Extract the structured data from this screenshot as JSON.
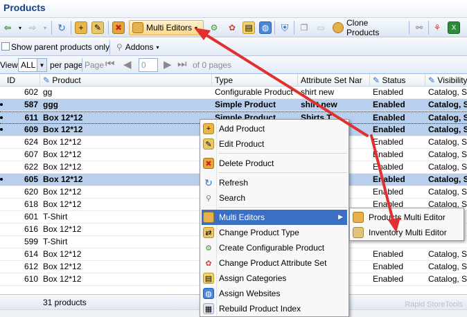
{
  "window": {
    "title": "Products"
  },
  "toolbar": {
    "multi_editors_label": "Multi Editors",
    "clone_products_label": "Clone Products"
  },
  "filters": {
    "show_parent_label": "Show parent products only",
    "addons_label": "Addons"
  },
  "pager": {
    "view_label": "View",
    "per_page_value": "ALL",
    "per_page_label": "per page",
    "page_label": "Page",
    "page_value": "0",
    "of_pages": "of 0 pages"
  },
  "grid": {
    "columns": [
      "ID",
      "Product",
      "Type",
      "Attribute Set Nar",
      "Status",
      "Visibility"
    ],
    "rows": [
      {
        "id": "602",
        "product": "gg",
        "type": "Configurable Product",
        "attr": "shirt new",
        "status": "Enabled",
        "visibility": "Catalog, Sea",
        "selected": false
      },
      {
        "id": "587",
        "product": "ggg",
        "type": "Simple Product",
        "attr": "shirt new",
        "status": "Enabled",
        "visibility": "Catalog, Sea",
        "selected": true
      },
      {
        "id": "611",
        "product": "Box 12*12",
        "type": "Simple Product",
        "attr": "Shirts T",
        "status": "Enabled",
        "visibility": "Catalog, Sea",
        "selected": true
      },
      {
        "id": "609",
        "product": "Box 12*12",
        "type": "",
        "attr": "",
        "status": "Enabled",
        "visibility": "Catalog, Sea",
        "selected": true
      },
      {
        "id": "624",
        "product": "Box 12*12",
        "type": "",
        "attr": "",
        "status": "Enabled",
        "visibility": "Catalog, Sea",
        "selected": false
      },
      {
        "id": "607",
        "product": "Box 12*12",
        "type": "",
        "attr": "",
        "status": "Enabled",
        "visibility": "Catalog, Sea",
        "selected": false
      },
      {
        "id": "622",
        "product": "Box 12*12",
        "type": "",
        "attr": "",
        "status": "Enabled",
        "visibility": "Catalog, Sea",
        "selected": false
      },
      {
        "id": "605",
        "product": "Box 12*12",
        "type": "",
        "attr": "",
        "status": "Enabled",
        "visibility": "Catalog, Sea",
        "selected": true
      },
      {
        "id": "620",
        "product": "Box 12*12",
        "type": "",
        "attr": "",
        "status": "Enabled",
        "visibility": "Catalog, Sea",
        "selected": false
      },
      {
        "id": "618",
        "product": "Box 12*12",
        "type": "",
        "attr": "",
        "status": "Enabled",
        "visibility": "Catalog, Sea",
        "selected": false
      },
      {
        "id": "601",
        "product": "T-Shirt",
        "type": "",
        "attr": "",
        "status": "",
        "visibility": "",
        "selected": false
      },
      {
        "id": "616",
        "product": "Box 12*12",
        "type": "",
        "attr": "",
        "status": "",
        "visibility": "",
        "selected": false
      },
      {
        "id": "599",
        "product": "T-Shirt",
        "type": "",
        "attr": "",
        "status": "",
        "visibility": "",
        "selected": false
      },
      {
        "id": "614",
        "product": "Box 12*12",
        "type": "",
        "attr": "",
        "status": "Enabled",
        "visibility": "Catalog, Sea",
        "selected": false
      },
      {
        "id": "612",
        "product": "Box 12*12",
        "type": "",
        "attr": "",
        "status": "Enabled",
        "visibility": "Catalog, Sea",
        "selected": false
      },
      {
        "id": "610",
        "product": "Box 12*12",
        "type": "",
        "attr": "",
        "status": "Enabled",
        "visibility": "Catalog, Sea",
        "selected": false
      }
    ],
    "footer_count": "31 products"
  },
  "context_menu": {
    "items": [
      {
        "label": "Add Product",
        "icon": "add-product-icon"
      },
      {
        "label": "Edit Product",
        "icon": "edit-product-icon"
      },
      {
        "label": "Delete Product",
        "icon": "delete-product-icon"
      },
      {
        "label": "Refresh",
        "icon": "refresh-icon"
      },
      {
        "label": "Search",
        "icon": "search-icon"
      },
      {
        "label": "Multi Editors",
        "icon": "multi-editors-icon"
      },
      {
        "label": "Change Product Type",
        "icon": "change-type-icon"
      },
      {
        "label": "Create Configurable Product",
        "icon": "configurable-icon"
      },
      {
        "label": "Change Product Attribute Set",
        "icon": "attribute-set-icon"
      },
      {
        "label": "Assign Categories",
        "icon": "categories-icon"
      },
      {
        "label": "Assign Websites",
        "icon": "websites-icon"
      },
      {
        "label": "Rebuild Product Index",
        "icon": "rebuild-index-icon"
      }
    ]
  },
  "submenu": {
    "items": [
      {
        "label": "Products Multi Editor",
        "icon": "products-multi-editor-icon"
      },
      {
        "label": "Inventory Multi Editor",
        "icon": "inventory-multi-editor-icon"
      }
    ]
  },
  "watermark": "Rapid StoreTools",
  "colors": {
    "selection": "#b8d0ee",
    "menu_highlight": "#3a6fc4",
    "annotation_arrow": "#e0312e"
  }
}
